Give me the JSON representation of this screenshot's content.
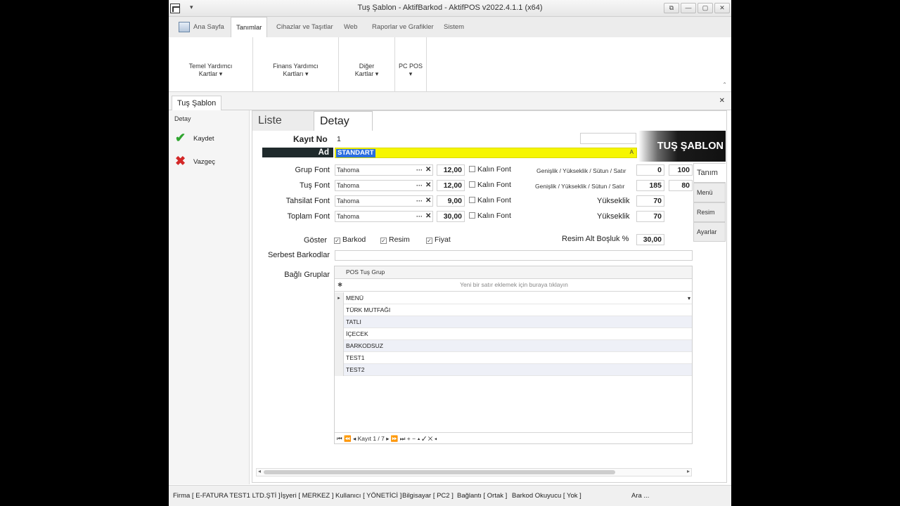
{
  "window": {
    "title": "Tuş Şablon - AktifBarkod - AktifPOS v2022.4.1.1 (x64)",
    "quick_access": "▾",
    "controls": [
      "⧉",
      "—",
      "▢",
      "✕"
    ]
  },
  "ribbon": {
    "tabs": [
      "Ana Sayfa",
      "Tanımlar",
      "Cihazlar ve Taşıtlar",
      "Web",
      "Raporlar ve Grafikler",
      "Sistem"
    ],
    "active_tab": "Tanımlar",
    "groups": [
      {
        "line1": "Temel Yardımcı",
        "line2": "Kartlar ▾"
      },
      {
        "line1": "Finans Yardımcı",
        "line2": "Kartları ▾"
      },
      {
        "line1": "Diğer",
        "line2": "Kartlar ▾"
      },
      {
        "line1": "PC POS",
        "line2": "▾"
      }
    ],
    "collapse": "⌃"
  },
  "doc_tab": {
    "label": "Tuş Şablon",
    "close": "✕"
  },
  "left_panel": {
    "title": "Detay",
    "items": [
      {
        "label": "Kaydet",
        "icon": "checkmark-icon",
        "color": "#2fa52f"
      },
      {
        "label": "Vazgeç",
        "icon": "cross-icon",
        "color": "#d32727"
      }
    ]
  },
  "content": {
    "tabs": [
      "Liste",
      "Detay"
    ],
    "active_tab": "Detay",
    "kayit_no_label": "Kayıt No",
    "kayit_no_value": "1",
    "ad_label": "Ad",
    "ad_value": "STANDART",
    "ad_hint": "A",
    "logo_text": "TUŞ ŞABLON",
    "highlight_color": "#f6f600",
    "fonts": [
      {
        "label": "Grup Font",
        "font": "Tahoma",
        "size": "12,00",
        "bold": "Kalın Font",
        "dim_label": "Genişlik / Yükseklik / Sütun / Satır",
        "v1": "0",
        "v2": "100"
      },
      {
        "label": "Tuş Font",
        "font": "Tahoma",
        "size": "12,00",
        "bold": "Kalın Font",
        "dim_label": "Genişlik / Yükseklik / Sütun / Satır",
        "v1": "185",
        "v2": "80"
      },
      {
        "label": "Tahsilat Font",
        "font": "Tahoma",
        "size": "9,00",
        "bold": "Kalın Font",
        "dim_label": "Yükseklik",
        "v1": "70"
      },
      {
        "label": "Toplam Font",
        "font": "Tahoma",
        "size": "30,00",
        "bold": "Kalın Font",
        "dim_label": "Yükseklik",
        "v1": "70"
      }
    ],
    "combo_dots": "···",
    "combo_clear": "✕",
    "goster_label": "Göster",
    "goster_options": [
      {
        "label": "Barkod",
        "checked": true
      },
      {
        "label": "Resim",
        "checked": true
      },
      {
        "label": "Fiyat",
        "checked": true
      }
    ],
    "resim_alt_label": "Resim Alt Boşluk %",
    "resim_alt_value": "30,00",
    "serbest_label": "Serbest Barkodlar",
    "bagli_label": "Bağlı Gruplar",
    "grid": {
      "column": "POS Tuş Grup",
      "new_row_hint": "Yeni bir satır eklemek için buraya tıklayın",
      "new_row_marker": "✱",
      "rows": [
        "MENÜ",
        "TÜRK MUTFAĞI",
        "TATLI",
        "İÇECEK",
        "BARKODSUZ",
        "TEST1",
        "TEST2"
      ],
      "dropdown": "▾",
      "navigator": "⏮  ⏪  ◂  Kayıt 1 / 7  ▸  ⏩  ⏭  +  −  ▴  ✓  ✕  ◂"
    },
    "side_tabs": [
      "Tanım",
      "Menü",
      "Resim",
      "Ayarlar"
    ],
    "active_side_tab": "Tanım"
  },
  "status_bar": [
    "Firma [ E-FATURA TEST1 LTD.ŞTİ ]",
    "İşyeri [ MERKEZ ]",
    "Kullanıcı [ YÖNETİCİ ]",
    "Bilgisayar [ PC2 ]",
    "Bağlantı [ Ortak ]",
    "Barkod Okuyucu [ Yok ]",
    "Ara ..."
  ]
}
